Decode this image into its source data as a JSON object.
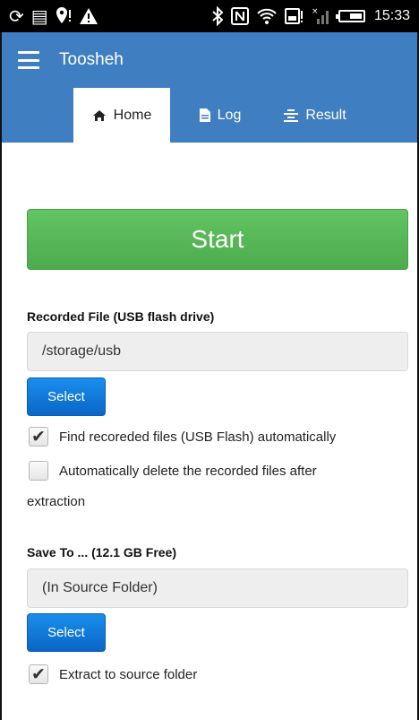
{
  "status_bar": {
    "time": "15:33",
    "icons": [
      "sync-icon",
      "message-icon",
      "location-alert-icon",
      "warning-icon",
      "bluetooth-icon",
      "nfc-icon",
      "wifi-icon",
      "storage-alert-icon",
      "signal-icon",
      "battery-icon"
    ],
    "battery_level": 0.6
  },
  "app_bar": {
    "title": "Toosheh"
  },
  "tabs": [
    {
      "label": "Home",
      "icon": "home-icon",
      "active": true
    },
    {
      "label": "Log",
      "icon": "file-icon",
      "active": false
    },
    {
      "label": "Result",
      "icon": "align-icon",
      "active": false
    }
  ],
  "main": {
    "start_label": "Start",
    "recorded": {
      "label": "Recorded File (USB flash drive)",
      "path": "/storage/usb",
      "select_label": "Select"
    },
    "options": {
      "find_auto": {
        "label": "Find recoreded files (USB Flash) automatically",
        "checked": true
      },
      "auto_delete": {
        "label_line1": "Automatically delete the recorded files after",
        "label_line2": "extraction",
        "checked": false
      }
    },
    "save_to": {
      "label": "Save To ... (12.1 GB Free)",
      "path": "(In Source Folder)",
      "select_label": "Select"
    },
    "extract_to_source": {
      "label": "Extract to source folder",
      "checked": true
    }
  },
  "colors": {
    "primary": "#3f7ec1",
    "start_green": "#5cb85c",
    "select_blue": "#0f7ad9"
  }
}
